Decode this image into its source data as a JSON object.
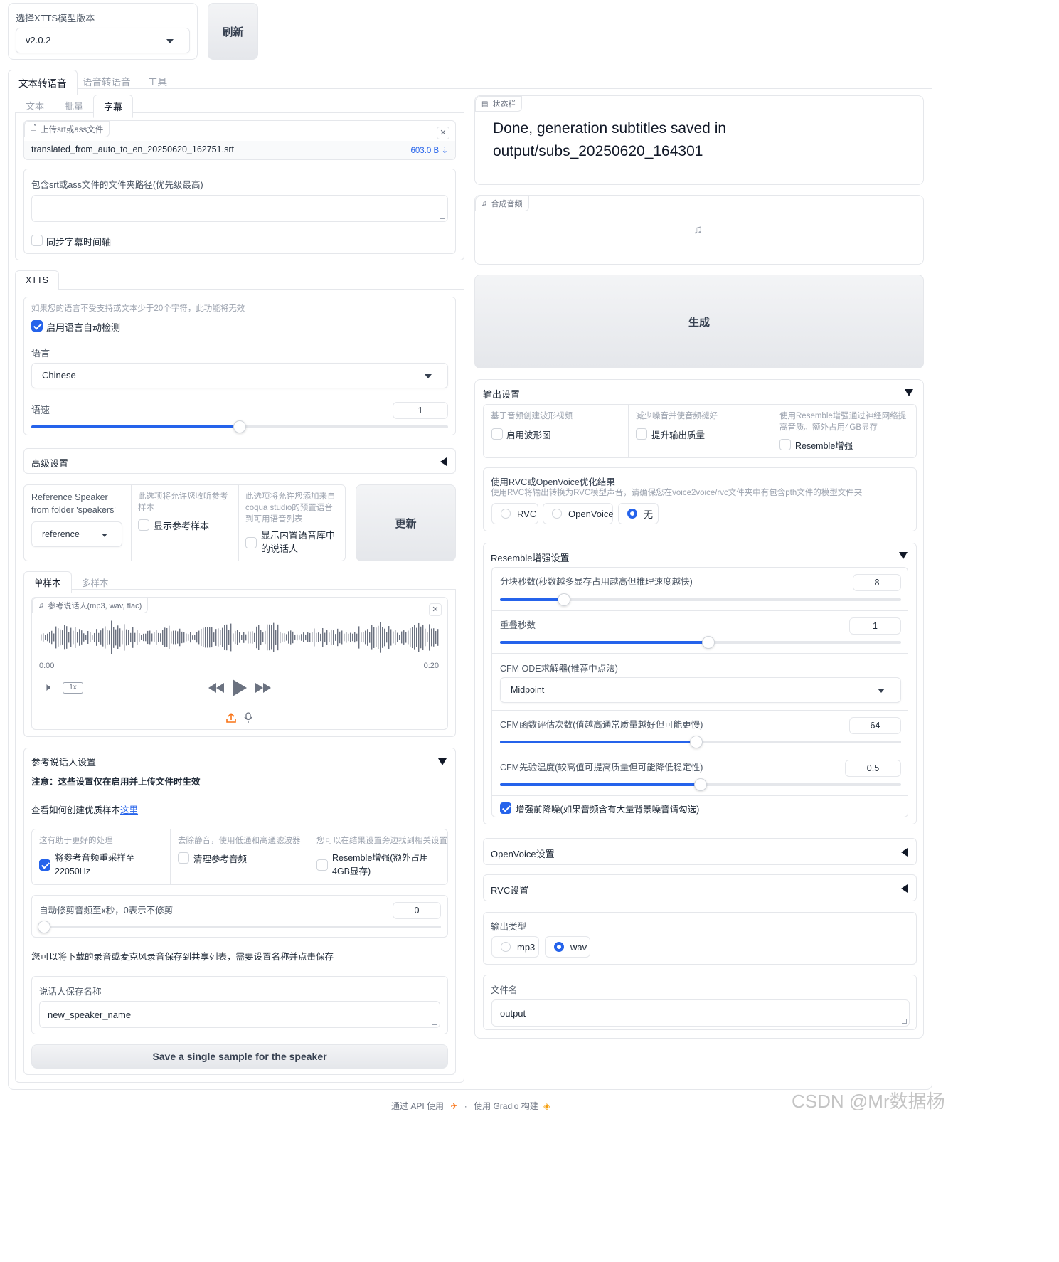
{
  "model": {
    "label": "选择XTTS模型版本",
    "value": "v2.0.2",
    "refresh": "刷新"
  },
  "top_tabs": [
    "文本转语音",
    "语音转语音",
    "工具"
  ],
  "sub_tabs": [
    "文本",
    "批量",
    "字幕"
  ],
  "upload": {
    "label": "上传srt或ass文件",
    "filename": "translated_from_auto_to_en_20250620_162751.srt",
    "size": "603.0 B ⇣"
  },
  "folder_path": {
    "label": "包含srt或ass文件的文件夹路径(优先级最高)",
    "value": ""
  },
  "sync_label": "同步字幕时间轴",
  "xtts_tab": "XTTS",
  "autodetect": {
    "hint": "如果您的语言不受支持或文本少于20个字符，此功能将无效",
    "label": "启用语言自动检测"
  },
  "language": {
    "label": "语言",
    "value": "Chinese"
  },
  "speed": {
    "label": "语速",
    "value": "1",
    "fraction": 0.5
  },
  "advanced": "高级设置",
  "speaker_ref": {
    "label": "Reference Speaker from folder 'speakers'",
    "value": "reference"
  },
  "show_ref": {
    "hint": "此选项将允许您收听参考样本",
    "label": "显示参考样本"
  },
  "show_builtin": {
    "hint": "此选项将允许您添加来自coqua studio的预置语音到可用语音列表",
    "label": "显示内置语音库中的说话人"
  },
  "update_btn": "更新",
  "sample_tabs": [
    "单样本",
    "多样本"
  ],
  "ref_audio": {
    "label": "参考说话人(mp3, wav, flac)",
    "start": "0:00",
    "end": "0:20",
    "speed": "1x"
  },
  "ref_settings": {
    "title": "参考说话人设置",
    "note": "注意：这些设置仅在启用并上传文件时生效",
    "howto": "查看如何创建优质样本",
    "link": "这里"
  },
  "opt1": {
    "hint": "这有助于更好的处理",
    "label": "将参考音频重采样至22050Hz"
  },
  "opt2": {
    "hint": "去除静音，使用低通和高通滤波器",
    "label": "清理参考音频"
  },
  "opt3": {
    "hint": "您可以在结果设置旁边找到相关设置",
    "label": "Resemble增强(额外占用4GB显存)"
  },
  "trim": {
    "label": "自动修剪音频至x秒，0表示不修剪",
    "value": "0",
    "fraction": 0
  },
  "save_hint": "您可以将下载的录音或麦克风录音保存到共享列表，需要设置名称并点击保存",
  "speaker_name": {
    "label": "说话人保存名称",
    "value": "new_speaker_name"
  },
  "save_btn": "Save a single sample for the speaker",
  "status": {
    "label": "状态栏",
    "text": "Done, generation subtitles saved in output/subs_20250620_164301"
  },
  "audio_out": "合成音频",
  "generate": "生成",
  "output_settings": {
    "title": "输出设置",
    "a": {
      "hint": "基于音频创建波形视频",
      "label": "启用波形图"
    },
    "b": {
      "hint": "减少噪音并使音频褪好",
      "label": "提升输出质量"
    },
    "c": {
      "hint": "使用Resemble增强通过神经网络提高音质。额外占用4GB显存",
      "label": "Resemble增强"
    }
  },
  "rvc": {
    "title": "使用RVC或OpenVoice优化结果",
    "hint": "使用RVC将输出转换为RVC模型声音，请确保您在voice2voice/rvc文件夹中有包含pth文件的模型文件夹",
    "options": [
      "RVC",
      "OpenVoice",
      "无"
    ],
    "selected": "无"
  },
  "resemble": {
    "title": "Resemble增强设置",
    "chunk": {
      "label": "分块秒数(秒数越多显存占用越高但推理速度越快)",
      "value": "8",
      "fraction": 0.16
    },
    "overlap": {
      "label": "重叠秒数",
      "value": "1",
      "fraction": 0.52
    },
    "solver": {
      "label": "CFM ODE求解器(推荐中点法)",
      "value": "Midpoint"
    },
    "nfe": {
      "label": "CFM函数评估次数(值越高通常质量越好但可能更慢)",
      "value": "64",
      "fraction": 0.49
    },
    "temp": {
      "label": "CFM先验温度(较高值可提高质量但可能降低稳定性)",
      "value": "0.5",
      "fraction": 0.5
    },
    "denoise": "增强前降噪(如果音频含有大量背景噪音请勾选)"
  },
  "openvoice_settings": "OpenVoice设置",
  "rvc_settings": "RVC设置",
  "output_type": {
    "label": "输出类型",
    "options": [
      "mp3",
      "wav"
    ],
    "selected": "wav"
  },
  "filename": {
    "label": "文件名",
    "value": "output"
  },
  "footer": {
    "api": "通过 API 使用",
    "built": "使用 Gradio 构建"
  },
  "watermark": "CSDN @Mr数据杨",
  "colors": {
    "accent": "#2563eb",
    "link": "#2563eb"
  }
}
